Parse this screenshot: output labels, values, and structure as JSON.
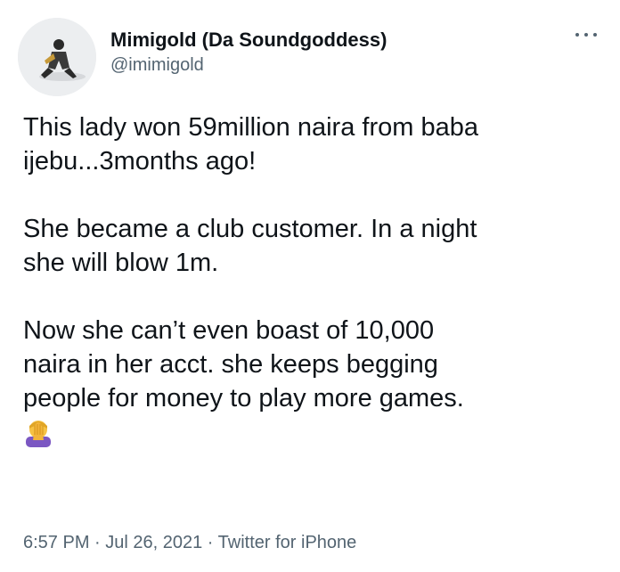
{
  "user": {
    "display_name": "Mimigold (Da Soundgoddess)",
    "handle": "@imimigold",
    "avatar_icon": "profile-avatar"
  },
  "menu": {
    "icon": "more-options-icon"
  },
  "tweet": {
    "line1": "This lady won 59million naira from baba",
    "line2": "ijebu...3months ago!",
    "line3": "She became a club customer. In a night",
    "line4": "she will blow 1m.",
    "line5": "Now she can’t even boast of 10,000",
    "line6": "naira in her acct. she keeps begging",
    "line7": "people for money to play more games.",
    "emoji": "facepalm-emoji"
  },
  "meta": {
    "time": "6:57 PM",
    "separator1": " · ",
    "date": "Jul 26, 2021",
    "separator2": " · ",
    "source": "Twitter for iPhone"
  },
  "colors": {
    "text": "#0f1419",
    "secondary": "#536471",
    "background": "#ffffff"
  }
}
